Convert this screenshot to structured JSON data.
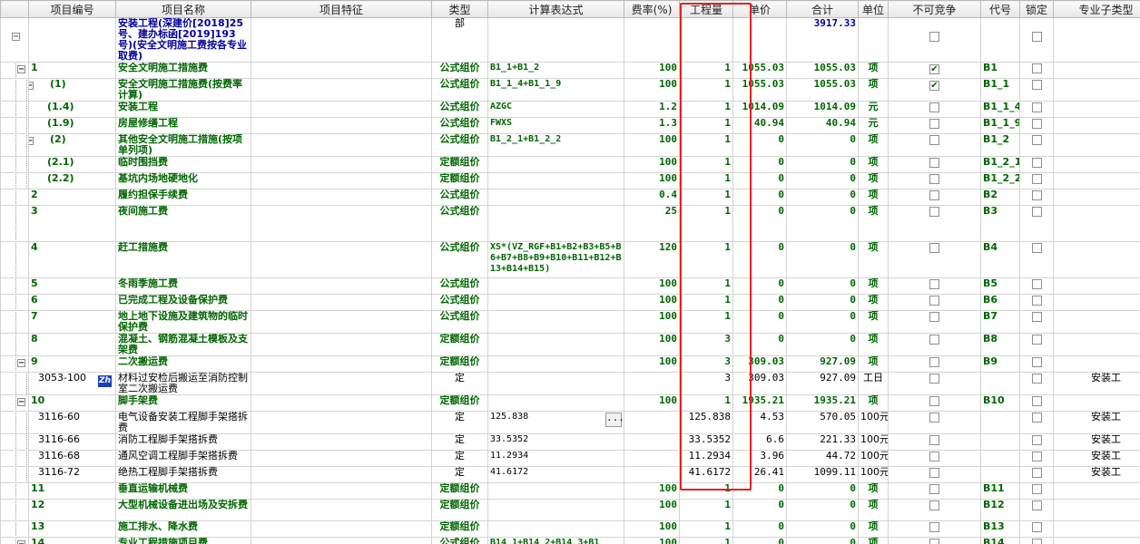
{
  "columns": {
    "code": "项目编号",
    "name": "项目名称",
    "feature": "项目特征",
    "type": "类型",
    "expr": "计算表达式",
    "fee": "费率(%)",
    "qty": "工程量",
    "price": "单价",
    "total": "合计",
    "unit": "单位",
    "noncompete": "不可竞争",
    "alias": "代号",
    "lock": "锁定",
    "subtype": "专业子类型"
  },
  "colors": {
    "group_text": "#006600",
    "top_row_bg": "#e7e9fb",
    "selected_row_bg": "#bcd6f2",
    "qty_column_bg": "#ececec",
    "highlight_border": "#e32222"
  },
  "rows": [
    {
      "kind": "top",
      "level": 0,
      "box": "minus",
      "code": "",
      "name": "安装工程(深建价[2018]25号、建办标函[2019]193号)(安全文明施工费按各专业取费)",
      "type": "部",
      "expr": "",
      "fee": "",
      "qty": "",
      "price": "",
      "total": "3917.33",
      "unit": "",
      "noncompete": false,
      "alias": "",
      "lock": false,
      "subtype": ""
    },
    {
      "kind": "main",
      "level": 1,
      "box": "minus",
      "code": "1",
      "name": "安全文明施工措施费",
      "type": "公式组价",
      "expr": "B1_1+B1_2",
      "fee": "100",
      "qty": "1",
      "price": "1055.03",
      "total": "1055.03",
      "unit": "项",
      "noncompete": true,
      "alias": "B1",
      "lock": false,
      "subtype": ""
    },
    {
      "kind": "main",
      "level": 2,
      "box": "minus",
      "code": "(1)",
      "name": "安全文明施工措施费(按费率计算)",
      "type": "公式组价",
      "expr": "B1_1_4+B1_1_9",
      "fee": "100",
      "qty": "1",
      "price": "1055.03",
      "total": "1055.03",
      "unit": "项",
      "noncompete": true,
      "alias": "B1_1",
      "lock": false,
      "subtype": ""
    },
    {
      "kind": "main",
      "level": 3,
      "box": "",
      "code": "(1.4)",
      "name": "安装工程",
      "type": "公式组价",
      "expr": "AZGC",
      "fee": "1.2",
      "qty": "1",
      "price": "1014.09",
      "total": "1014.09",
      "unit": "元",
      "noncompete": false,
      "alias": "B1_1_4",
      "lock": false,
      "subtype": ""
    },
    {
      "kind": "main",
      "level": 3,
      "box": "",
      "code": "(1.9)",
      "name": "房屋修缮工程",
      "type": "公式组价",
      "expr": "FWXS",
      "fee": "1.3",
      "qty": "1",
      "price": "40.94",
      "total": "40.94",
      "unit": "元",
      "noncompete": false,
      "alias": "B1_1_9",
      "lock": false,
      "subtype": ""
    },
    {
      "kind": "main",
      "level": 2,
      "box": "minus",
      "code": "(2)",
      "name": "其他安全文明施工措施(按项单列项)",
      "type": "公式组价",
      "expr": "B1_2_1+B1_2_2",
      "fee": "100",
      "qty": "1",
      "price": "0",
      "total": "0",
      "unit": "项",
      "noncompete": false,
      "alias": "B1_2",
      "lock": false,
      "subtype": ""
    },
    {
      "kind": "main",
      "level": 3,
      "box": "",
      "code": "(2.1)",
      "name": "临时围挡费",
      "type": "定额组价",
      "expr": "",
      "fee": "100",
      "qty": "1",
      "price": "0",
      "total": "0",
      "unit": "项",
      "noncompete": false,
      "alias": "B1_2_1",
      "lock": false,
      "subtype": ""
    },
    {
      "kind": "main",
      "level": 3,
      "box": "",
      "code": "(2.2)",
      "name": "基坑内场地硬地化",
      "type": "定额组价",
      "expr": "",
      "fee": "100",
      "qty": "1",
      "price": "0",
      "total": "0",
      "unit": "项",
      "noncompete": false,
      "alias": "B1_2_2",
      "lock": false,
      "subtype": ""
    },
    {
      "kind": "main",
      "level": 1,
      "box": "",
      "code": "2",
      "name": "履约担保手续费",
      "type": "公式组价",
      "expr": "",
      "fee": "0.4",
      "qty": "1",
      "price": "0",
      "total": "0",
      "unit": "项",
      "noncompete": false,
      "alias": "B2",
      "lock": false,
      "subtype": ""
    },
    {
      "kind": "main",
      "level": 1,
      "box": "",
      "code": "3",
      "name": "夜间施工费",
      "type": "公式组价",
      "expr": "",
      "fee": "25",
      "qty": "1",
      "price": "0",
      "total": "0",
      "unit": "项",
      "noncompete": false,
      "alias": "B3",
      "lock": false,
      "subtype": ""
    },
    {
      "kind": "main",
      "level": 1,
      "box": "",
      "code": "4",
      "name": "赶工措施费",
      "type": "公式组价",
      "expr": "XS*(VZ_RGF+B1+B2+B3+B5+B6+B7+B8+B9+B10+B11+B12+B13+B14+B15)",
      "fee": "120",
      "qty": "1",
      "price": "0",
      "total": "0",
      "unit": "项",
      "noncompete": false,
      "alias": "B4",
      "lock": false,
      "subtype": ""
    },
    {
      "kind": "main",
      "level": 1,
      "box": "",
      "code": "5",
      "name": "冬雨季施工费",
      "type": "公式组价",
      "expr": "",
      "fee": "100",
      "qty": "1",
      "price": "0",
      "total": "0",
      "unit": "项",
      "noncompete": false,
      "alias": "B5",
      "lock": false,
      "subtype": ""
    },
    {
      "kind": "main",
      "level": 1,
      "box": "",
      "code": "6",
      "name": "已完成工程及设备保护费",
      "type": "公式组价",
      "expr": "",
      "fee": "100",
      "qty": "1",
      "price": "0",
      "total": "0",
      "unit": "项",
      "noncompete": false,
      "alias": "B6",
      "lock": false,
      "subtype": ""
    },
    {
      "kind": "main",
      "level": 1,
      "box": "",
      "code": "7",
      "name": "地上地下设施及建筑物的临时保护费",
      "type": "公式组价",
      "expr": "",
      "fee": "100",
      "qty": "1",
      "price": "0",
      "total": "0",
      "unit": "项",
      "noncompete": false,
      "alias": "B7",
      "lock": false,
      "subtype": ""
    },
    {
      "kind": "main",
      "level": 1,
      "box": "",
      "code": "8",
      "name": "混凝土、钢筋混凝土模板及支架费",
      "type": "定额组价",
      "expr": "",
      "fee": "100",
      "qty": "3",
      "price": "0",
      "total": "0",
      "unit": "项",
      "noncompete": false,
      "alias": "B8",
      "lock": false,
      "subtype": ""
    },
    {
      "kind": "main",
      "level": 1,
      "box": "minus",
      "code": "9",
      "name": "二次搬运费",
      "type": "定额组价",
      "expr": "",
      "fee": "100",
      "qty": "3",
      "price": "309.03",
      "total": "927.09",
      "unit": "项",
      "noncompete": false,
      "alias": "B9",
      "lock": false,
      "subtype": ""
    },
    {
      "kind": "item",
      "level": 2,
      "box": "",
      "zh": "Zh",
      "code": "3053-100",
      "name": "材料过安检后搬运至消防控制室二次搬运费",
      "type": "定",
      "expr": "",
      "fee": "",
      "qty": "3",
      "price": "309.03",
      "total": "927.09",
      "unit": "工日",
      "noncompete": false,
      "alias": "",
      "lock": false,
      "subtype": "安装工"
    },
    {
      "kind": "main",
      "level": 1,
      "box": "minus",
      "code": "10",
      "name": "脚手架费",
      "type": "定额组价",
      "expr": "",
      "fee": "100",
      "qty": "1",
      "price": "1935.21",
      "total": "1935.21",
      "unit": "项",
      "noncompete": false,
      "alias": "B10",
      "lock": false,
      "subtype": ""
    },
    {
      "kind": "sel",
      "level": 2,
      "box": "",
      "dots": "...",
      "code": "3116-60",
      "name": "电气设备安装工程脚手架搭拆费",
      "type": "定",
      "expr": "125.838",
      "fee": "",
      "qty": "125.838",
      "price": "4.53",
      "total": "570.05",
      "unit": "100元",
      "noncompete": false,
      "alias": "",
      "lock": false,
      "subtype": "安装工"
    },
    {
      "kind": "item",
      "level": 2,
      "box": "",
      "code": "3116-66",
      "name": "消防工程脚手架搭拆费",
      "type": "定",
      "expr": "33.5352",
      "fee": "",
      "qty": "33.5352",
      "price": "6.6",
      "total": "221.33",
      "unit": "100元",
      "noncompete": false,
      "alias": "",
      "lock": false,
      "subtype": "安装工"
    },
    {
      "kind": "item",
      "level": 2,
      "box": "",
      "code": "3116-68",
      "name": "通风空调工程脚手架搭拆费",
      "type": "定",
      "expr": "11.2934",
      "fee": "",
      "qty": "11.2934",
      "price": "3.96",
      "total": "44.72",
      "unit": "100元",
      "noncompete": false,
      "alias": "",
      "lock": false,
      "subtype": "安装工"
    },
    {
      "kind": "item",
      "level": 2,
      "box": "",
      "code": "3116-72",
      "name": "绝热工程脚手架搭拆费",
      "type": "定",
      "expr": "41.6172",
      "fee": "",
      "qty": "41.6172",
      "price": "26.41",
      "total": "1099.11",
      "unit": "100元",
      "noncompete": false,
      "alias": "",
      "lock": false,
      "subtype": "安装工"
    },
    {
      "kind": "main",
      "level": 1,
      "box": "",
      "code": "11",
      "name": "垂直运输机械费",
      "type": "定额组价",
      "expr": "",
      "fee": "100",
      "qty": "1",
      "price": "0",
      "total": "0",
      "unit": "项",
      "noncompete": false,
      "alias": "B11",
      "lock": false,
      "subtype": ""
    },
    {
      "kind": "main",
      "level": 1,
      "box": "",
      "code": "12",
      "name": "大型机械设备进出场及安拆费",
      "type": "定额组价",
      "expr": "",
      "fee": "100",
      "qty": "1",
      "price": "0",
      "total": "0",
      "unit": "项",
      "noncompete": false,
      "alias": "B12",
      "lock": false,
      "subtype": ""
    },
    {
      "kind": "main",
      "level": 1,
      "box": "",
      "code": "13",
      "name": "施工排水、降水费",
      "type": "定额组价",
      "expr": "",
      "fee": "100",
      "qty": "1",
      "price": "0",
      "total": "0",
      "unit": "项",
      "noncompete": false,
      "alias": "B13",
      "lock": false,
      "subtype": ""
    },
    {
      "kind": "main",
      "level": 1,
      "box": "minus",
      "code": "14",
      "name": "专业工程措施项目费",
      "type": "公式组价",
      "expr": "B14_1+B14_2+B14_3+B1",
      "fee": "100",
      "qty": "1",
      "price": "0",
      "total": "0",
      "unit": "项",
      "noncompete": false,
      "alias": "B14",
      "lock": false,
      "subtype": ""
    }
  ]
}
